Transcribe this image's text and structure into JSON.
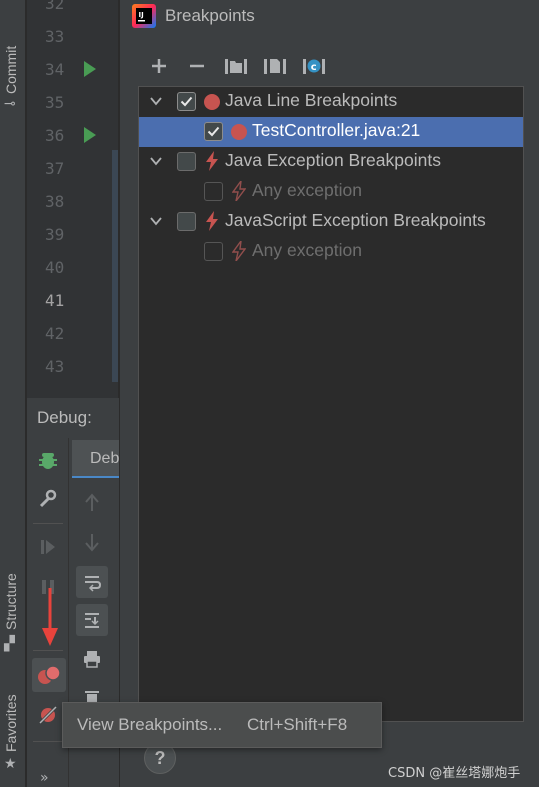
{
  "left_strip": {
    "commit_label": "Commit",
    "structure_label": "Structure",
    "favorites_label": "Favorites"
  },
  "editor": {
    "line_numbers": [
      "32",
      "33",
      "34",
      "35",
      "36",
      "37",
      "38",
      "39",
      "40",
      "41",
      "42",
      "43"
    ],
    "current_line": "41"
  },
  "debug": {
    "title": "Debug:",
    "tab_label": "Debugger",
    "more_glyph": "»"
  },
  "dialog": {
    "title": "Breakpoints",
    "toolbar": [
      "add-icon",
      "remove-icon",
      "group-folder-icon",
      "group-file-icon",
      "group-class-icon"
    ],
    "tree": {
      "groups": [
        {
          "label": "Java Line Breakpoints",
          "checked": true,
          "icon": "red-dot-icon",
          "children": [
            {
              "label": "TestController.java:21",
              "checked": true,
              "selected": true,
              "icon": "red-dot-icon"
            }
          ]
        },
        {
          "label": "Java Exception Breakpoints",
          "checked": false,
          "icon": "lightning-icon",
          "children": [
            {
              "label": "Any exception",
              "checked": false,
              "disabled": true,
              "icon": "lightning-icon"
            }
          ]
        },
        {
          "label": "JavaScript Exception Breakpoints",
          "checked": false,
          "icon": "lightning-icon",
          "children": [
            {
              "label": "Any exception",
              "checked": false,
              "disabled": true,
              "icon": "lightning-icon"
            }
          ]
        }
      ]
    },
    "help_label": "?"
  },
  "tooltip": {
    "label": "View Breakpoints...",
    "shortcut": "Ctrl+Shift+F8"
  },
  "watermark": "CSDN @崔丝塔娜炮手",
  "colors": {
    "accent_selection": "#4b6eaf",
    "breakpoint_red": "#c75450",
    "run_green": "#499c54",
    "annotation_arrow": "#e8433c"
  }
}
